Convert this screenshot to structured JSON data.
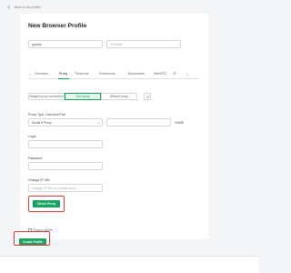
{
  "back": {
    "label": "Back to all profiles"
  },
  "title": "New Browser Profile",
  "profile": {
    "name_value": "pypnay",
    "folder_placeholder": "No folder"
  },
  "tabs": [
    "Overview",
    "Proxy",
    "Timezone",
    "Extensions",
    "Bookmarks",
    "WebRTC",
    "B"
  ],
  "active_tab": "Proxy",
  "proxy_modes": [
    "Straight proxy connection",
    "Your proxy",
    "Without proxy"
  ],
  "proxy_mode_selected": "Your proxy",
  "proxy_type": {
    "label": "Proxy Type, Host and Port",
    "value": "Socks 5 Proxy",
    "host_placeholder": "",
    "port_value": "10658"
  },
  "login": {
    "label": "Login",
    "value": ""
  },
  "password": {
    "label": "Password",
    "placeholder": ""
  },
  "change_ip": {
    "label": "Change IP URL",
    "placeholder": "Change IP URL for mobile proxy"
  },
  "check_button": "Check Proxy",
  "proxy_status": "Proxy is online!",
  "proxy_ip": "",
  "create_button": "Create Profile",
  "colors": {
    "accent": "#1aa260",
    "highlight": "#e03b3b"
  }
}
